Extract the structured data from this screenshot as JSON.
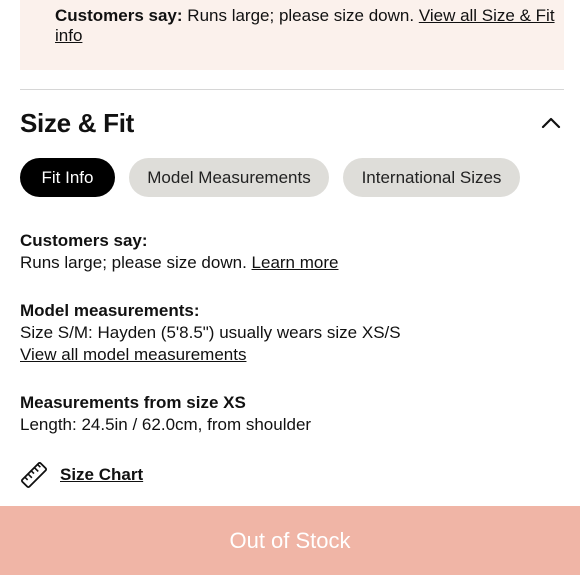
{
  "notice": {
    "customers_say_label": "Customers say:",
    "customers_say_text": " Runs large; please size down. ",
    "view_all_link": "View all Size & Fit info"
  },
  "size_fit": {
    "title": "Size & Fit",
    "tabs": [
      {
        "label": "Fit Info",
        "active": true
      },
      {
        "label": "Model Measurements",
        "active": false
      },
      {
        "label": "International Sizes",
        "active": false
      }
    ]
  },
  "fit_info": {
    "customers_say": {
      "heading": "Customers say:",
      "text": "Runs large; please size down. ",
      "link": "Learn more"
    },
    "model_measurements": {
      "heading": "Model measurements:",
      "text": "Size S/M: Hayden (5'8.5\") usually wears size XS/S",
      "link": "View all model measurements"
    },
    "measurements": {
      "heading": "Measurements from size XS",
      "text": "Length: 24.5in / 62.0cm, from shoulder"
    },
    "size_chart_label": "Size Chart"
  },
  "cta": {
    "label": "Out of Stock"
  },
  "colors": {
    "notice_bg": "#fbf1ec",
    "active_tab": "#000000",
    "inactive_tab": "#deddd9",
    "cta_bg": "#f0b5a6"
  }
}
